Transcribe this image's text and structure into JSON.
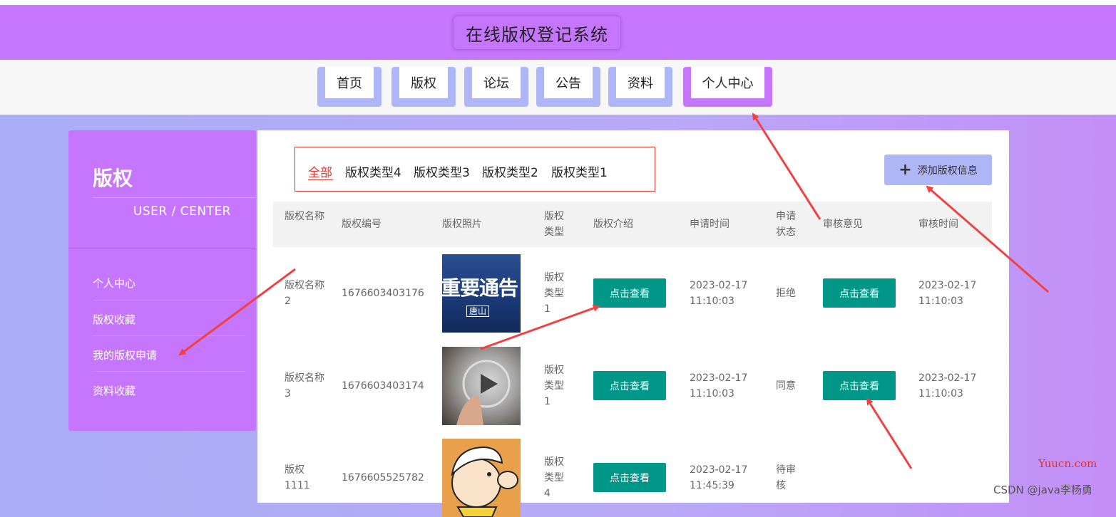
{
  "app": {
    "title": "在线版权登记系统"
  },
  "nav": {
    "items": [
      {
        "label": "首页"
      },
      {
        "label": "版权"
      },
      {
        "label": "论坛"
      },
      {
        "label": "公告"
      },
      {
        "label": "资料"
      },
      {
        "label": "个人中心",
        "active": true
      }
    ]
  },
  "sidebar": {
    "title": "版权",
    "subtitle": "USER / CENTER",
    "items": [
      {
        "label": "个人中心"
      },
      {
        "label": "版权收藏"
      },
      {
        "label": "我的版权申请"
      },
      {
        "label": "资料收藏"
      }
    ]
  },
  "filters": {
    "tabs": [
      {
        "label": "全部",
        "active": true
      },
      {
        "label": "版权类型4"
      },
      {
        "label": "版权类型3"
      },
      {
        "label": "版权类型2"
      },
      {
        "label": "版权类型1"
      }
    ]
  },
  "add_button": {
    "label": "添加版权信息",
    "icon": "plus-icon"
  },
  "table": {
    "headers": {
      "name": "版权名称",
      "number": "版权编号",
      "photo": "版权照片",
      "type": "版权类型",
      "intro": "版权介绍",
      "apply_time": "申请时间",
      "status": "申请状态",
      "review": "审核意见",
      "review_time": "审核时间"
    },
    "view_label": "点击查看",
    "rows": [
      {
        "name": "版权名称2",
        "number": "1676603403176",
        "photo_text": "重要通告",
        "photo_logo": "唐山",
        "type": "版权类型1",
        "apply_time": "2023-02-17 11:10:03",
        "status": "拒绝",
        "review_time": "2023-02-17 11:10:03"
      },
      {
        "name": "版权名称3",
        "number": "1676603403174",
        "type": "版权类型1",
        "apply_time": "2023-02-17 11:10:03",
        "status": "同意",
        "review_time": "2023-02-17 11:10:03"
      },
      {
        "name": "版权1111",
        "number": "1676605525782",
        "type": "版权类型4",
        "apply_time": "2023-02-17 11:45:39",
        "status": "待审核",
        "review_time": ""
      }
    ]
  },
  "watermarks": {
    "site": "Yuucn.com",
    "author": "CSDN @java李杨勇"
  },
  "colors": {
    "brand": "#c675fd",
    "nav_tab": "#afb6f6",
    "action": "#009688",
    "filter_border": "#d9392f",
    "arrow": "#f24040"
  }
}
